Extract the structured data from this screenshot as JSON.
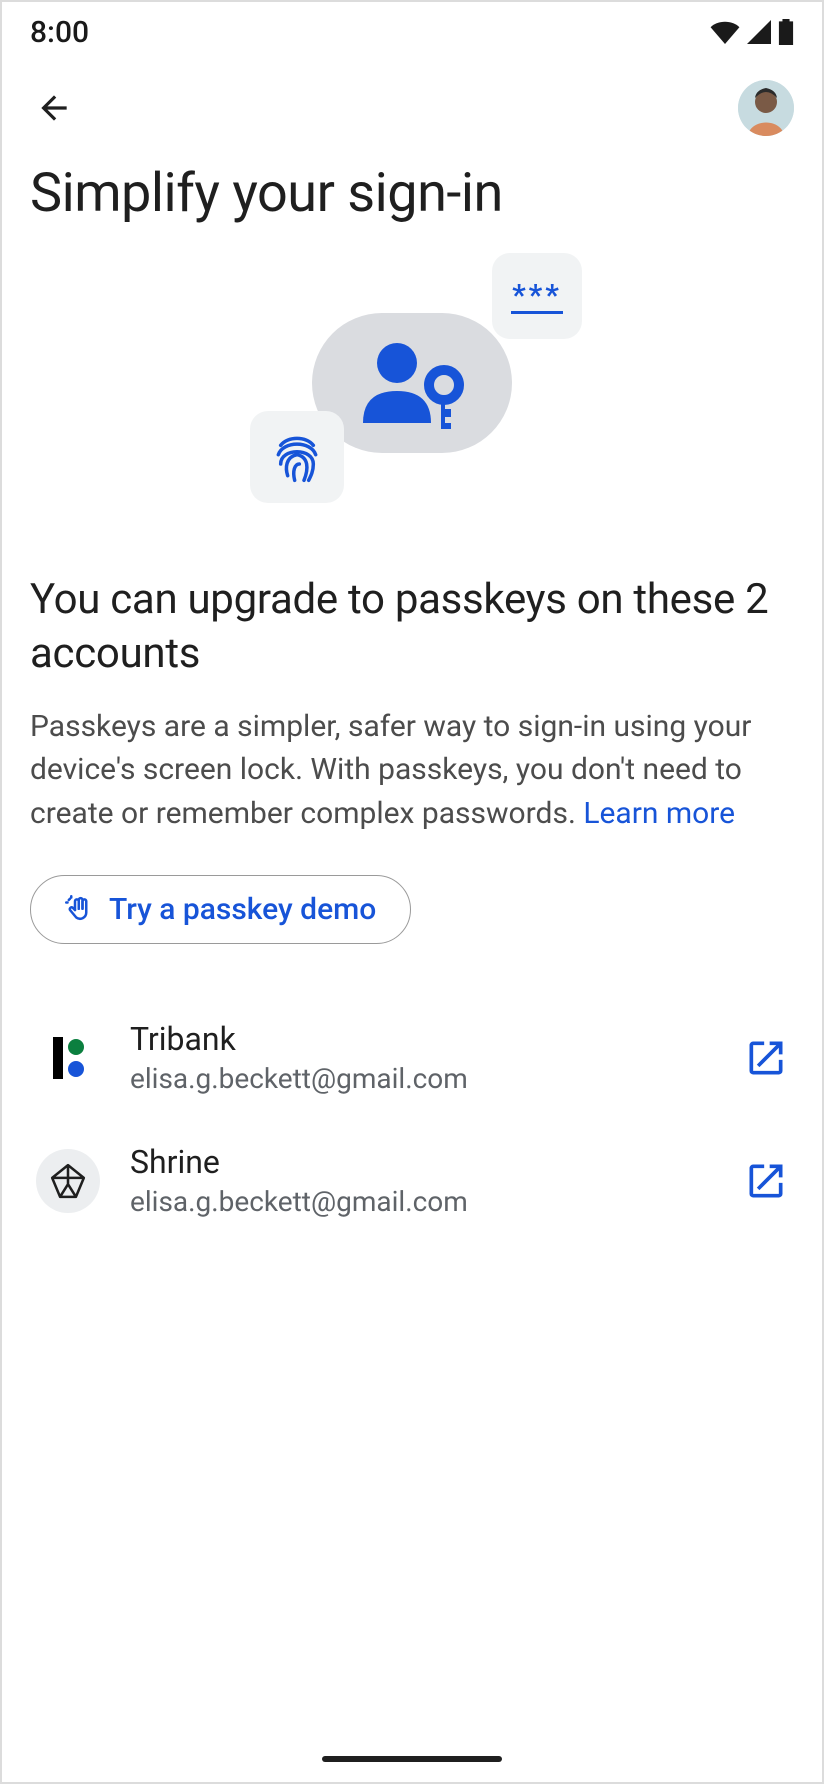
{
  "status": {
    "time": "8:00"
  },
  "page": {
    "title": "Simplify your sign-in",
    "sub_heading": "You can upgrade to passkeys on these 2 accounts",
    "body": "Passkeys are a simpler, safer way to sign-in using your device's screen lock. With passkeys, you don't need to create or remember complex passwords. ",
    "learn_more": "Learn more",
    "demo_button": "Try a passkey demo",
    "hero_password_mask": "***"
  },
  "accounts": [
    {
      "name": "Tribank",
      "email": "elisa.g.beckett@gmail.com",
      "icon": "tribank"
    },
    {
      "name": "Shrine",
      "email": "elisa.g.beckett@gmail.com",
      "icon": "shrine"
    }
  ],
  "colors": {
    "accent": "#1754d8",
    "icon_bg": "#f1f3f4",
    "hero_bg": "#dadce0"
  }
}
